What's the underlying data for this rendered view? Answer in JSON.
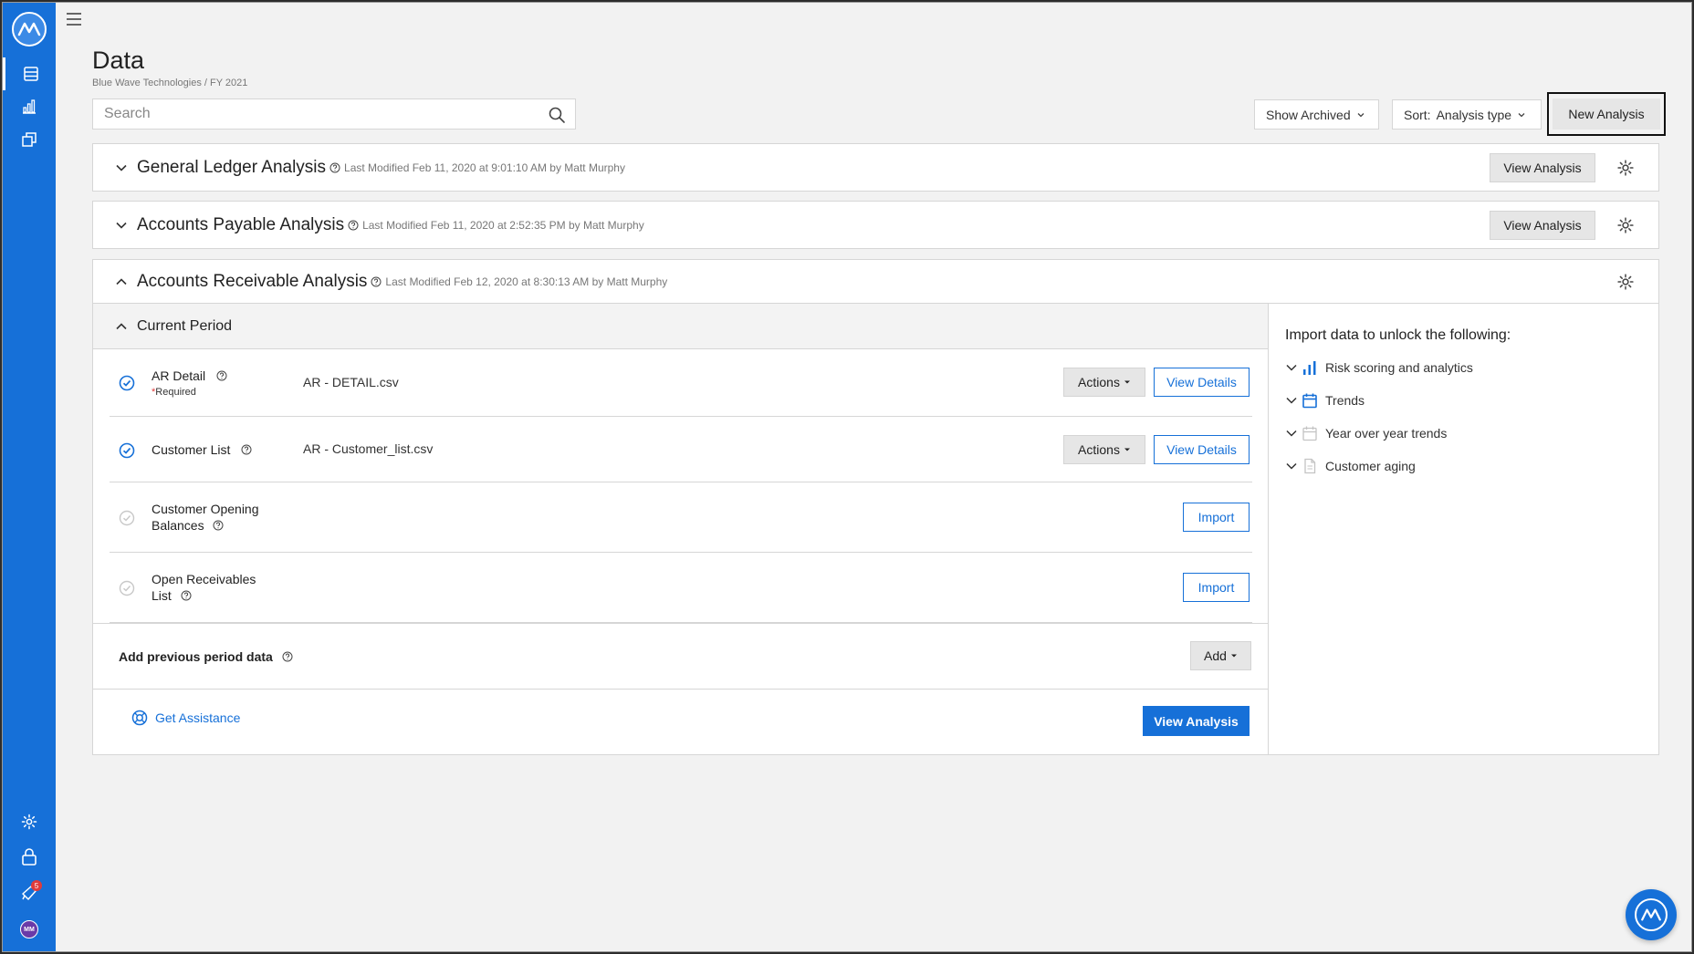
{
  "header": {
    "title": "Data",
    "breadcrumb": "Blue Wave Technologies / FY 2021",
    "search_placeholder": "Search",
    "show_archived": "Show Archived",
    "sort_label": "Sort:",
    "sort_value": "Analysis type",
    "new_analysis": "New Analysis"
  },
  "analyses": [
    {
      "title": "General Ledger Analysis",
      "modified": "Last Modified Feb 11, 2020 at 9:01:10 AM by Matt Murphy",
      "view_label": "View Analysis",
      "expanded": false
    },
    {
      "title": "Accounts Payable Analysis",
      "modified": "Last Modified Feb 11, 2020 at 2:52:35 PM by Matt Murphy",
      "view_label": "View Analysis",
      "expanded": false
    },
    {
      "title": "Accounts Receivable Analysis",
      "modified": "Last Modified Feb 12, 2020 at 8:30:13 AM by Matt Murphy",
      "expanded": true
    }
  ],
  "current_period": {
    "title": "Current Period",
    "rows": [
      {
        "name": "AR Detail",
        "required_mark": "*",
        "required_text": "Required",
        "file": "AR - DETAIL.csv",
        "actions": "Actions",
        "view": "View Details",
        "status": "complete"
      },
      {
        "name": "Customer List",
        "file": "AR - Customer_list.csv",
        "actions": "Actions",
        "view": "View Details",
        "status": "complete"
      },
      {
        "name_line1": "Customer Opening",
        "name_line2": "Balances",
        "import": "Import",
        "status": "pending"
      },
      {
        "name_line1": "Open Receivables",
        "name_line2": "List",
        "import": "Import",
        "status": "pending"
      }
    ],
    "add_previous": "Add previous period data",
    "add_label": "Add",
    "get_assistance": "Get Assistance",
    "view_analysis": "View Analysis"
  },
  "unlock": {
    "title": "Import data to unlock the following:",
    "items": [
      {
        "label": "Risk scoring and analytics",
        "icon": "bar-chart-icon",
        "active": true
      },
      {
        "label": "Trends",
        "icon": "calendar-icon",
        "active": true
      },
      {
        "label": "Year over year trends",
        "icon": "calendar-icon",
        "active": false
      },
      {
        "label": "Customer aging",
        "icon": "document-icon",
        "active": false
      }
    ]
  },
  "sidebar": {
    "notification_count": "5",
    "avatar_initials": "MM"
  },
  "colors": {
    "brand": "#1670d8",
    "background": "#f2f2f2",
    "badge": "#e03b3b"
  }
}
